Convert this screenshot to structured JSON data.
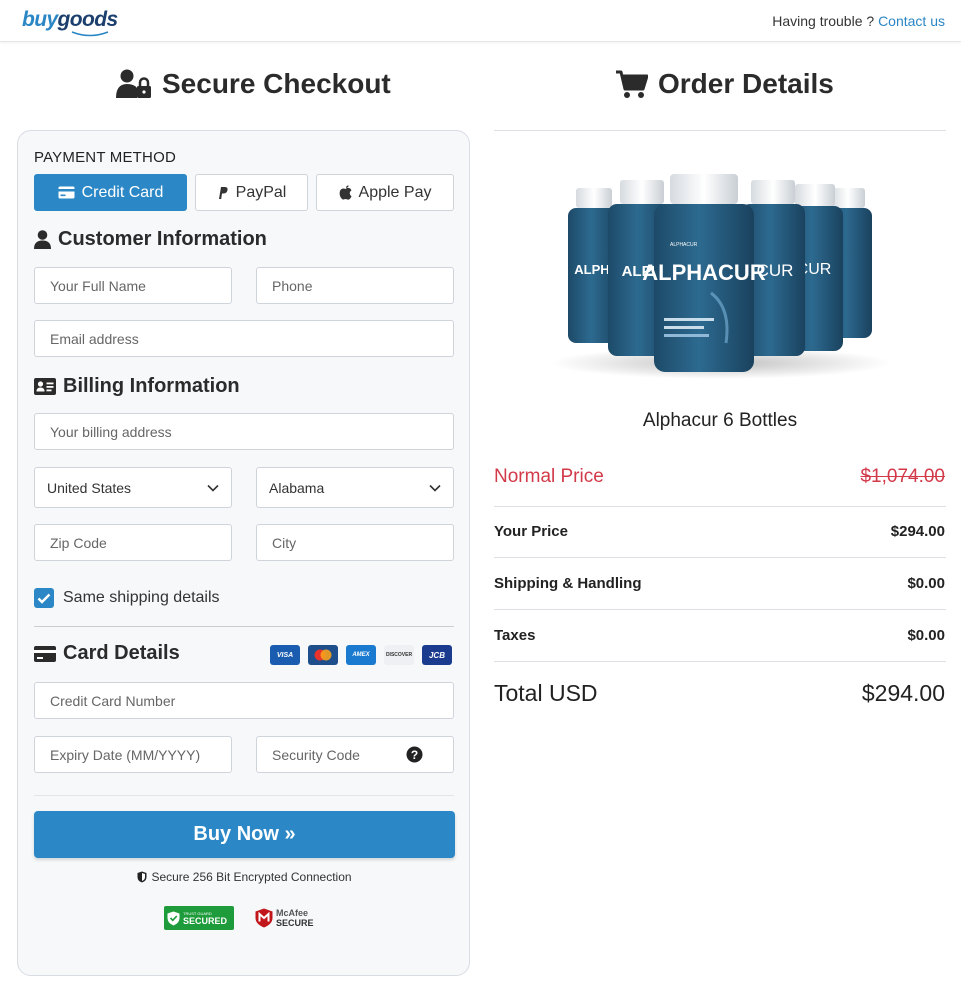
{
  "header": {
    "logo_buy": "buy",
    "logo_goods": "goods",
    "help_text": "Having trouble ?",
    "contact_link": "Contact us"
  },
  "checkout": {
    "title": "Secure Checkout",
    "payment_method_label": "PAYMENT METHOD",
    "payment_methods": [
      {
        "label": "Credit Card",
        "icon": "credit-card-icon",
        "active": true
      },
      {
        "label": "PayPal",
        "icon": "paypal-icon",
        "active": false
      },
      {
        "label": "Apple Pay",
        "icon": "apple-icon",
        "active": false
      }
    ],
    "customer_heading": "Customer Information",
    "billing_heading": "Billing Information",
    "card_heading": "Card Details",
    "placeholders": {
      "full_name": "Your Full Name",
      "phone": "Phone",
      "email": "Email address",
      "billing_address": "Your billing address",
      "zip": "Zip Code",
      "city": "City",
      "card_number": "Credit Card Number",
      "expiry": "Expiry Date (MM/YYYY)",
      "security_code": "Security Code"
    },
    "country_selected": "United States",
    "state_selected": "Alabama",
    "same_shipping_label": "Same shipping details",
    "same_shipping_checked": true,
    "card_brands": [
      "VISA",
      "MC",
      "AMEX",
      "DISCOVER",
      "JCB"
    ],
    "buy_button": "Buy Now »",
    "secure_text": "Secure 256 Bit Encrypted Connection",
    "badge_secured_top": "TRUST GUARD",
    "badge_secured_main": "SECURED",
    "badge_mcafee_line1": "McAfee",
    "badge_mcafee_line2": "SECURE"
  },
  "order": {
    "title": "Order Details",
    "product_name": "Alphacur 6 Bottles",
    "bottle_brand": "ALPHACUR",
    "bottle_label_small": "ALPHACUR",
    "normal_price_label": "Normal Price",
    "normal_price": "$1,074.00",
    "your_price_label": "Your Price",
    "your_price": "$294.00",
    "shipping_label": "Shipping & Handling",
    "shipping": "$0.00",
    "taxes_label": "Taxes",
    "taxes": "$0.00",
    "total_label": "Total USD",
    "total": "$294.00"
  },
  "colors": {
    "accent": "#2b87c5",
    "danger": "#d23a4a",
    "bottle": "#25587a"
  }
}
